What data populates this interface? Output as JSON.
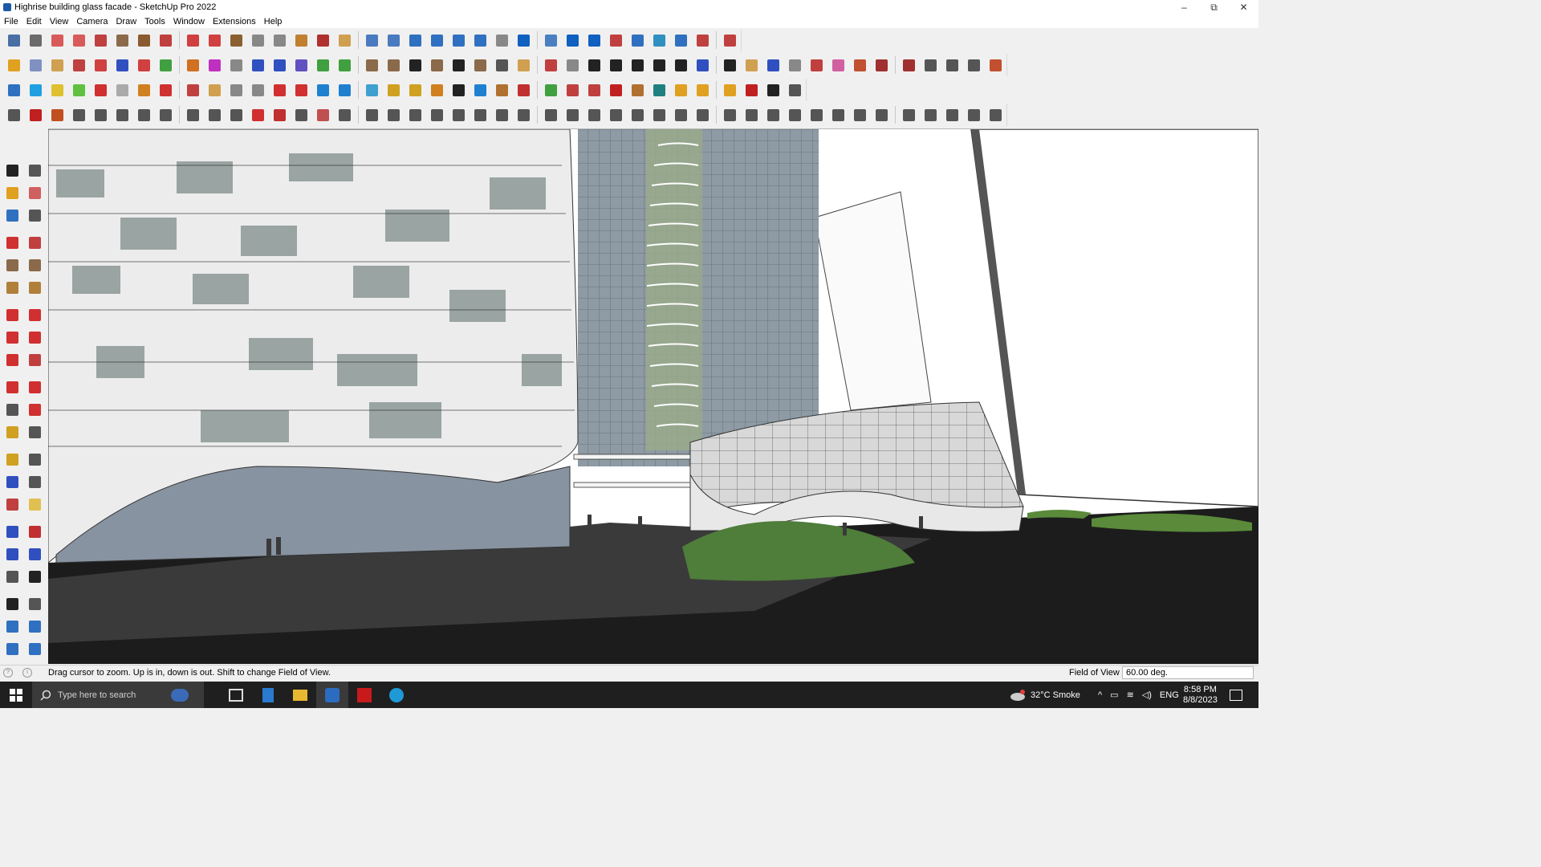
{
  "window": {
    "title": "Highrise building glass facade - SketchUp Pro 2022",
    "minimize": "–",
    "maximize": "⧉",
    "close": "✕"
  },
  "menu": [
    "File",
    "Edit",
    "View",
    "Camera",
    "Draw",
    "Tools",
    "Window",
    "Extensions",
    "Help"
  ],
  "toolbars": {
    "row1": [
      "#4a6fa5",
      "#6b6b6b",
      "#d95a5a",
      "#d95a5a",
      "#c04040",
      "#8a6a4a",
      "#8a5a30",
      "#c04040",
      "#d04040",
      "#d04040",
      "#8a6030",
      "#888",
      "#888",
      "#c08030",
      "#b03030",
      "#d0a050",
      "#4a7ac0",
      "#4a7ac0",
      "#3070c0",
      "#3070c0",
      "#3070c0",
      "#3070c0",
      "#888",
      "#1060c0",
      "#4a80c0",
      "#1060c0",
      "#1060c0",
      "#c04040",
      "#3070c0",
      "#3090c0",
      "#3070c0",
      "#c04040",
      "#c04040"
    ],
    "row2": [
      "#e0a020",
      "#8090c0",
      "#d0a050",
      "#c04040",
      "#d04040",
      "#3050c0",
      "#d04040",
      "#40a040",
      "#d07020",
      "#c030c0",
      "#888",
      "#3050c0",
      "#3050c0",
      "#6050c0",
      "#40a040",
      "#40a040",
      "#8a6a4a",
      "#8a6a4a",
      "#222",
      "#8a6a4a",
      "#222",
      "#8a6a4a",
      "#555",
      "#d0a050",
      "#c04040",
      "#888",
      "#222",
      "#222",
      "#222",
      "#222",
      "#222",
      "#3050c0",
      "#222",
      "#d0a050",
      "#3050c0",
      "#888",
      "#c04040",
      "#d060a0",
      "#c05030",
      "#a03030",
      "#a03030",
      "#555",
      "#555",
      "#555",
      "#c05030"
    ],
    "row3": [
      "#3070c0",
      "#20a0e0",
      "#e0c030",
      "#60c040",
      "#d03030",
      "#aaa",
      "#d08020",
      "#d03030",
      "#c04040",
      "#d0a050",
      "#888",
      "#888",
      "#d03030",
      "#d03030",
      "#2080d0",
      "#2080d0",
      "#40a0d0",
      "#d0a020",
      "#d0a020",
      "#d08020",
      "#222",
      "#2080d0",
      "#b07030",
      "#c03030",
      "#40a040",
      "#c04040",
      "#c04040",
      "#c02020",
      "#b07030",
      "#208080",
      "#e0a020",
      "#e0a020",
      "#e0a020",
      "#c02020",
      "#222",
      "#555"
    ],
    "row4": [
      "#555",
      "#c02020",
      "#c05020",
      "#555",
      "#555",
      "#555",
      "#555",
      "#555",
      "#555",
      "#555",
      "#555",
      "#d03030",
      "#c03030",
      "#555",
      "#c05050",
      "#555",
      "#555",
      "#555",
      "#555",
      "#555",
      "#555",
      "#555",
      "#555",
      "#555",
      "#555",
      "#555",
      "#555",
      "#555",
      "#555",
      "#555",
      "#555",
      "#555",
      "#555",
      "#555",
      "#555",
      "#555",
      "#555",
      "#555",
      "#555",
      "#555",
      "#555",
      "#555",
      "#555",
      "#555",
      "#555"
    ]
  },
  "left_toolbar": [
    "#222",
    "#555",
    "#e0a020",
    "#d06060",
    "#3070c0",
    "#555",
    "#d03030",
    "#c04040",
    "#8a6a4a",
    "#8a6a4a",
    "#b0803a",
    "#b0803a",
    "#d03030",
    "#d03030",
    "#d03030",
    "#d03030",
    "#d03030",
    "#c04040",
    "#d03030",
    "#d03030",
    "#555",
    "#d03030",
    "#d0a020",
    "#555",
    "#d0a020",
    "#555",
    "#3050c0",
    "#555",
    "#c04040",
    "#e0c050",
    "#3050c0",
    "#c03030",
    "#3050c0",
    "#3050c0",
    "#555",
    "#222",
    "#222",
    "#555",
    "#3070c0",
    "#3070c0",
    "#3070c0",
    "#3070c0"
  ],
  "status": {
    "message": "Drag cursor to zoom.  Up is in, down is out. Shift to change Field of View.",
    "vcb_label": "Field of View",
    "vcb_value": "60.00 deg."
  },
  "taskbar": {
    "search_placeholder": "Type here to search",
    "weather": "32°C  Smoke",
    "language": "ENG",
    "time": "8:58 PM",
    "date": "8/8/2023"
  }
}
